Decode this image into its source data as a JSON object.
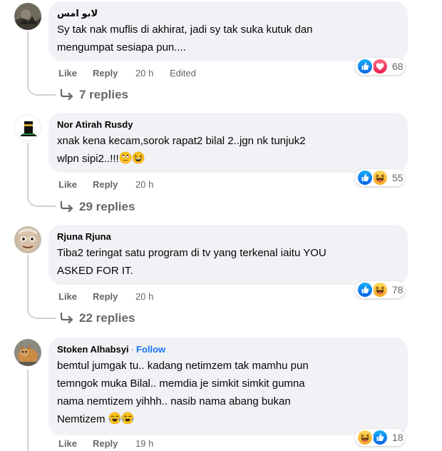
{
  "comments": [
    {
      "author": "لابو امس",
      "text": "Sy tak nak muflis di akhirat, jadi sy tak suka kutuk dan\nmengumpat sesiapa pun....",
      "like_label": "Like",
      "reply_label": "Reply",
      "time": "20 h",
      "edited": "Edited",
      "reaction_icons": [
        "like-reaction-icon",
        "love-reaction-icon"
      ],
      "reaction_count": "68",
      "replies_label": "7 replies"
    },
    {
      "author": "Nor Atirah Rusdy",
      "text": "xnak kena kecam,sorok rapat2 bilal 2..jgn nk tunjuk2\nwlpn sipi2..!!!",
      "text_emojis": [
        "rolling-eyes-emoji",
        "laughing-emoji"
      ],
      "like_label": "Like",
      "reply_label": "Reply",
      "time": "20 h",
      "reaction_icons": [
        "like-reaction-icon",
        "haha-reaction-icon"
      ],
      "reaction_count": "55",
      "replies_label": "29 replies"
    },
    {
      "author": "Rjuna Rjuna",
      "text": "Tiba2 teringat satu program di tv yang terkenal iaitu YOU\nASKED FOR IT.",
      "like_label": "Like",
      "reply_label": "Reply",
      "time": "20 h",
      "reaction_icons": [
        "like-reaction-icon",
        "haha-reaction-icon"
      ],
      "reaction_count": "78",
      "replies_label": "22 replies"
    },
    {
      "author": "Stoken Alhabsyi",
      "follow_label": "Follow",
      "dot": "·",
      "text": "bemtul jumgak tu.. kadang netimzem tak mamhu pun\ntemngok muka Bilal.. memdia je simkit simkit gumna\nnama nemtizem yihhh.. nasib nama abang bukan\nNemtizem",
      "text_emojis": [
        "crying-laughing-emoji",
        "crying-laughing-emoji"
      ],
      "like_label": "Like",
      "reply_label": "Reply",
      "time": "19 h",
      "reaction_icons": [
        "haha-reaction-icon",
        "like-reaction-icon"
      ],
      "reaction_count": "18"
    }
  ],
  "colors": {
    "bubble": "#f0f2f5",
    "meta": "#65676b",
    "link_blue": "#1877f2",
    "like_blue": "#1877f2",
    "love_red": "#f33e58",
    "haha_yellow": "#f7b928"
  }
}
